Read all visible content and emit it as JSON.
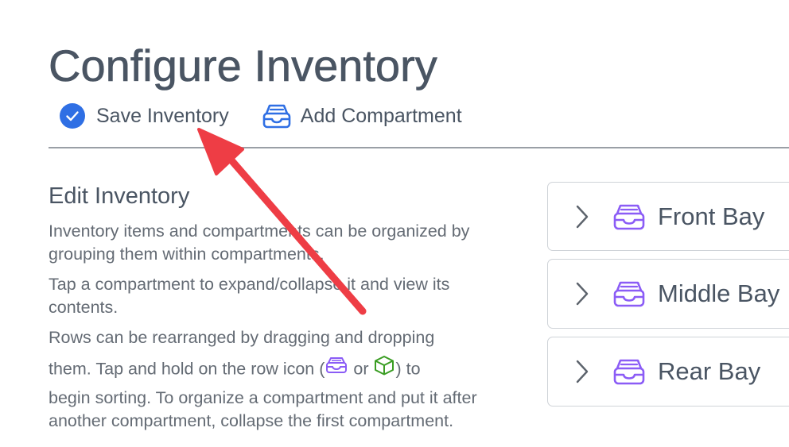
{
  "header": {
    "title": "Configure Inventory"
  },
  "toolbar": {
    "save_label": "Save Inventory",
    "save_icon": "check-circle-icon",
    "add_label": "Add Compartment",
    "add_icon": "inbox-tray-icon"
  },
  "help": {
    "title": "Edit Inventory",
    "p1": "Inventory items and compartments can be organized by grouping them within compartments.",
    "p2": "Tap a compartment to expand/collapse it and view its contents.",
    "p3_line1": "Rows can be rearranged by dragging and dropping",
    "p3_before": "them. Tap and hold on the row icon (",
    "p3_or": " or ",
    "p3_after": ") to",
    "p3_rest": "begin sorting. To organize a compartment and put it after another compartment, collapse the first compartment."
  },
  "compartments": [
    {
      "label": "Front Bay",
      "icon": "inbox-tray-icon"
    },
    {
      "label": "Middle Bay",
      "icon": "inbox-tray-icon"
    },
    {
      "label": "Rear Bay",
      "icon": "inbox-tray-icon"
    }
  ],
  "colors": {
    "accent_blue": "#2f6fe4",
    "compartment_purple": "#8b5cf6",
    "item_green": "#3a9d23",
    "annotation_red": "#ee3d45",
    "text": "#4a5563",
    "divider": "#9a9fa6"
  }
}
